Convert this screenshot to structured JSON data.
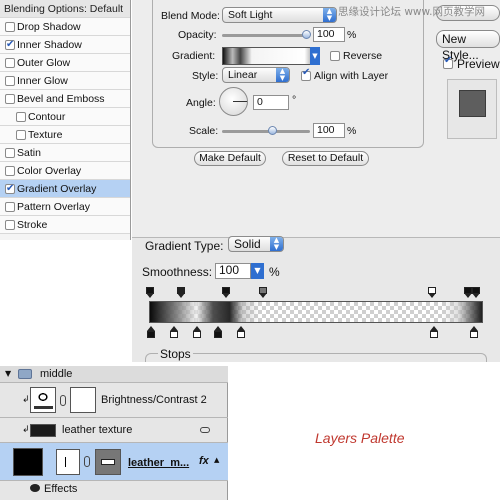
{
  "style_list": {
    "header": "Blending Options: Default",
    "items": [
      {
        "label": "Drop Shadow",
        "checked": false,
        "selected": false
      },
      {
        "label": "Inner Shadow",
        "checked": true,
        "selected": false
      },
      {
        "label": "Outer Glow",
        "checked": false,
        "selected": false
      },
      {
        "label": "Inner Glow",
        "checked": false,
        "selected": false
      },
      {
        "label": "Bevel and Emboss",
        "checked": false,
        "selected": false
      },
      {
        "label": "Contour",
        "checked": false,
        "selected": false
      },
      {
        "label": "Texture",
        "checked": false,
        "selected": false
      },
      {
        "label": "Satin",
        "checked": false,
        "selected": false
      },
      {
        "label": "Color Overlay",
        "checked": false,
        "selected": false
      },
      {
        "label": "Gradient Overlay",
        "checked": true,
        "selected": true
      },
      {
        "label": "Pattern Overlay",
        "checked": false,
        "selected": false
      },
      {
        "label": "Stroke",
        "checked": false,
        "selected": false
      }
    ]
  },
  "gradient_overlay": {
    "blend_mode_label": "Blend Mode:",
    "blend_mode_value": "Soft Light",
    "opacity_label": "Opacity:",
    "opacity_value": "100",
    "opacity_unit": "%",
    "gradient_label": "Gradient:",
    "reverse_label": "Reverse",
    "reverse_checked": false,
    "style_label": "Style:",
    "style_value": "Linear",
    "align_label": "Align with Layer",
    "align_checked": true,
    "angle_label": "Angle:",
    "angle_value": "0",
    "angle_unit": "°",
    "scale_label": "Scale:",
    "scale_value": "100",
    "scale_unit": "%",
    "make_default_label": "Make Default",
    "reset_default_label": "Reset to Default"
  },
  "right_column": {
    "new_style_label": "New Style...",
    "preview_label": "Preview",
    "preview_checked": true
  },
  "watermark": "思缘设计论坛 www.网页教学网",
  "gradient_editor": {
    "type_label": "Gradient Type:",
    "type_value": "Solid",
    "smoothness_label": "Smoothness:",
    "smoothness_value": "100",
    "smoothness_unit": "%",
    "stops_label": "Stops"
  },
  "layers": {
    "group_name": "middle",
    "rows": [
      {
        "name": "Brightness/Contrast 2"
      },
      {
        "name": "leather texture"
      },
      {
        "name": "leather_m..."
      }
    ],
    "effects_label": "Effects",
    "fx_label": "fx"
  },
  "caption": "Layers Palette",
  "colors": {
    "selection": "#b5d1f3",
    "accent": "#2f6fd0",
    "caption": "#c0382f"
  }
}
